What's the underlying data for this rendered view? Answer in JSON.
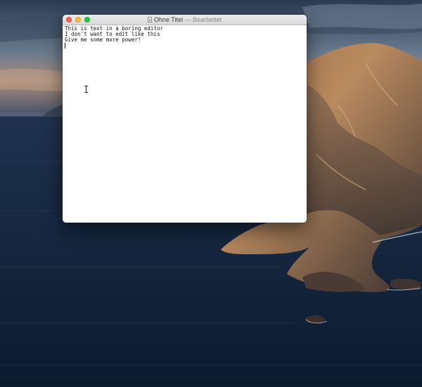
{
  "window": {
    "title": "Ohne Titel",
    "separator": "—",
    "status": "Bearbeitet"
  },
  "editor": {
    "lines": [
      "This is text in a boring editor",
      "I don't want to edit like this",
      "Give me some more power!"
    ]
  },
  "icons": {
    "close": "close-button",
    "minimize": "minimize-button",
    "zoom": "zoom-button",
    "document": "document-icon",
    "cursor": "text-cursor-icon"
  },
  "colors": {
    "close": "#ff5f57",
    "minimize": "#febc2e",
    "zoom": "#28c840",
    "titlebar": "#e4e4e4",
    "editor_bg": "#ffffff"
  }
}
